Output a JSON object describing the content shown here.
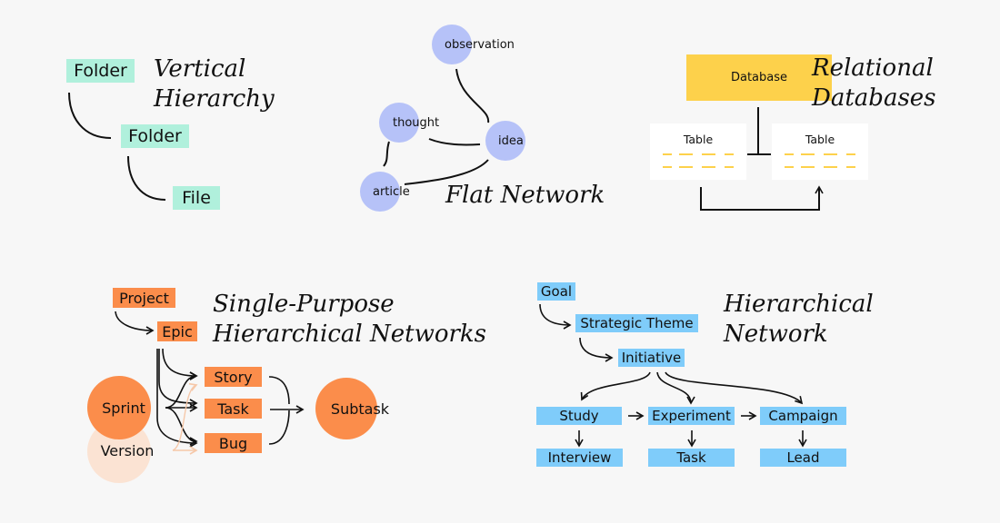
{
  "colors": {
    "background": "#f7f7f7",
    "teal": "#b0f0dc",
    "periwinkle": "#b6c2f8",
    "yellow": "#fdd14b",
    "orange": "#fb8d4b",
    "peach": "#fbe3d3",
    "blue": "#7fccfa"
  },
  "vertical_hierarchy": {
    "title_line1": "Vertical",
    "title_line2": "Hierarchy",
    "nodes": [
      "Folder",
      "Folder",
      "File"
    ]
  },
  "flat_network": {
    "title": "Flat Network",
    "nodes": [
      "observation",
      "thought",
      "idea",
      "article"
    ]
  },
  "relational_databases": {
    "title_line1": "Relational",
    "title_line2": "Databases",
    "database_label": "Database",
    "tables": [
      "Table",
      "Table"
    ]
  },
  "single_purpose": {
    "title_line1": "Single-Purpose",
    "title_line2": "Hierarchical Networks",
    "project": "Project",
    "epic": "Epic",
    "issues": [
      "Story",
      "Task",
      "Bug"
    ],
    "sprint": "Sprint",
    "version": "Version",
    "subtask": "Subtask"
  },
  "hierarchical_network": {
    "title_line1": "Hierarchical",
    "title_line2": "Network",
    "goal": "Goal",
    "theme": "Strategic Theme",
    "initiative": "Initiative",
    "row1": [
      "Study",
      "Experiment",
      "Campaign"
    ],
    "row2": [
      "Interview",
      "Task",
      "Lead"
    ]
  }
}
